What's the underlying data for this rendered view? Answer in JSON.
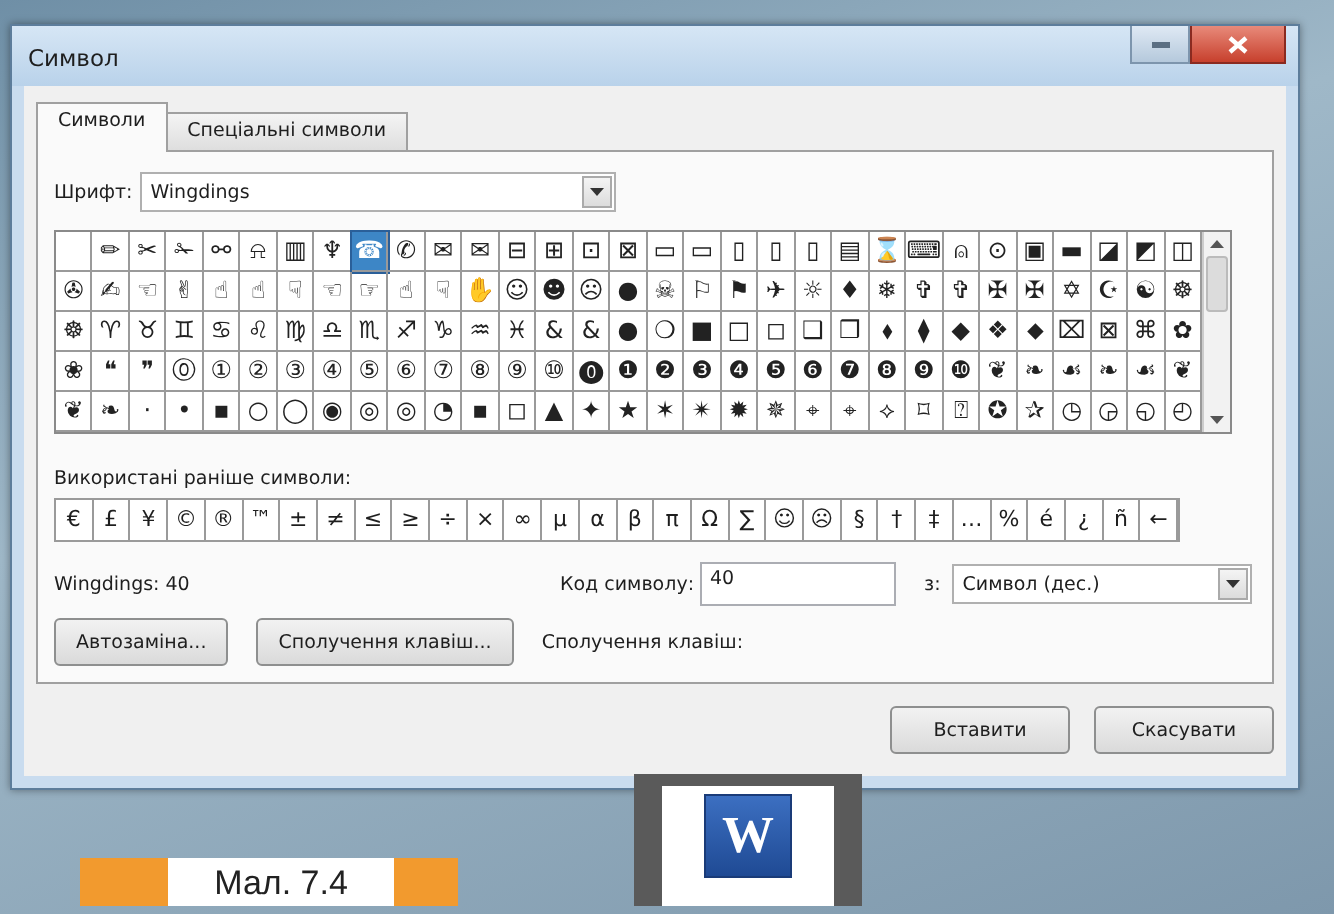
{
  "window": {
    "title": "Символ"
  },
  "tabs": [
    {
      "label": "Символи",
      "selected": true
    },
    {
      "label": "Спеціальні символи",
      "selected": false
    }
  ],
  "font": {
    "label": "Шрифт:",
    "value": "Wingdings"
  },
  "symbol_grid": {
    "rows": [
      {
        "cells": [
          {
            "selected": false
          },
          {
            "ch": "✏",
            "selected": false
          },
          {
            "ch": "✂",
            "selected": false
          },
          {
            "ch": "✁",
            "selected": false
          },
          {
            "ch": "⚯",
            "selected": false
          },
          {
            "ch": "⍾",
            "selected": false
          },
          {
            "ch": "▥",
            "selected": false
          },
          {
            "ch": "♆",
            "selected": false
          },
          {
            "ch": "☎",
            "selected": true
          },
          {
            "ch": "✆",
            "selected": false
          },
          {
            "ch": "✉",
            "selected": false
          },
          {
            "ch": "✉",
            "selected": false
          },
          {
            "ch": "⊟",
            "selected": false
          },
          {
            "ch": "⊞",
            "selected": false
          },
          {
            "ch": "⊡",
            "selected": false
          },
          {
            "ch": "⊠",
            "selected": false
          },
          {
            "ch": "▭",
            "selected": false
          },
          {
            "ch": "▭",
            "selected": false
          },
          {
            "ch": "▯",
            "selected": false
          },
          {
            "ch": "▯",
            "selected": false
          },
          {
            "ch": "▯",
            "selected": false
          },
          {
            "ch": "▤",
            "selected": false
          },
          {
            "ch": "⌛",
            "selected": false
          },
          {
            "ch": "⌨",
            "selected": false
          },
          {
            "ch": "⍝",
            "selected": false
          },
          {
            "ch": "⊙",
            "selected": false
          },
          {
            "ch": "▣",
            "selected": false
          },
          {
            "ch": "▬",
            "selected": false
          },
          {
            "ch": "◪",
            "selected": false
          },
          {
            "ch": "◩",
            "selected": false
          },
          {
            "ch": "◫",
            "selected": false
          }
        ]
      },
      {
        "cells": [
          {
            "ch": "✇",
            "selected": false
          },
          {
            "ch": "✍",
            "selected": false
          },
          {
            "ch": "☜",
            "selected": false
          },
          {
            "ch": "✌",
            "selected": false
          },
          {
            "ch": "☝",
            "selected": false
          },
          {
            "ch": "☝",
            "selected": false
          },
          {
            "ch": "☟",
            "selected": false
          },
          {
            "ch": "☜",
            "selected": false
          },
          {
            "ch": "☞",
            "selected": false
          },
          {
            "ch": "☝",
            "selected": false
          },
          {
            "ch": "☟",
            "selected": false
          },
          {
            "ch": "✋",
            "selected": false
          },
          {
            "ch": "☺",
            "selected": false
          },
          {
            "ch": "☻",
            "selected": false
          },
          {
            "ch": "☹",
            "selected": false
          },
          {
            "ch": "●",
            "selected": false
          },
          {
            "ch": "☠",
            "selected": false
          },
          {
            "ch": "⚐",
            "selected": false
          },
          {
            "ch": "⚑",
            "selected": false
          },
          {
            "ch": "✈",
            "selected": false
          },
          {
            "ch": "☼",
            "selected": false
          },
          {
            "ch": "♦",
            "selected": false
          },
          {
            "ch": "❄",
            "selected": false
          },
          {
            "ch": "✞",
            "selected": false
          },
          {
            "ch": "✞",
            "selected": false
          },
          {
            "ch": "✠",
            "selected": false
          },
          {
            "ch": "✠",
            "selected": false
          },
          {
            "ch": "✡",
            "selected": false
          },
          {
            "ch": "☪",
            "selected": false
          },
          {
            "ch": "☯",
            "selected": false
          },
          {
            "ch": "☸",
            "selected": false
          }
        ]
      },
      {
        "cells": [
          {
            "ch": "☸",
            "selected": false
          },
          {
            "ch": "♈",
            "selected": false
          },
          {
            "ch": "♉",
            "selected": false
          },
          {
            "ch": "♊",
            "selected": false
          },
          {
            "ch": "♋",
            "selected": false
          },
          {
            "ch": "♌",
            "selected": false
          },
          {
            "ch": "♍",
            "selected": false
          },
          {
            "ch": "♎",
            "selected": false
          },
          {
            "ch": "♏",
            "selected": false
          },
          {
            "ch": "♐",
            "selected": false
          },
          {
            "ch": "♑",
            "selected": false
          },
          {
            "ch": "♒",
            "selected": false
          },
          {
            "ch": "♓",
            "selected": false
          },
          {
            "ch": "&",
            "selected": false
          },
          {
            "ch": "&",
            "selected": false
          },
          {
            "ch": "●",
            "selected": false
          },
          {
            "ch": "❍",
            "selected": false
          },
          {
            "ch": "■",
            "selected": false
          },
          {
            "ch": "□",
            "selected": false
          },
          {
            "ch": "◻",
            "selected": false
          },
          {
            "ch": "❑",
            "selected": false
          },
          {
            "ch": "❒",
            "selected": false
          },
          {
            "ch": "⬧",
            "selected": false
          },
          {
            "ch": "⧫",
            "selected": false
          },
          {
            "ch": "◆",
            "selected": false
          },
          {
            "ch": "❖",
            "selected": false
          },
          {
            "ch": "⬥",
            "selected": false
          },
          {
            "ch": "⌧",
            "selected": false
          },
          {
            "ch": "⊠",
            "selected": false
          },
          {
            "ch": "⌘",
            "selected": false
          },
          {
            "ch": "✿",
            "selected": false
          }
        ]
      },
      {
        "cells": [
          {
            "ch": "❀",
            "selected": false
          },
          {
            "ch": "❝",
            "selected": false
          },
          {
            "ch": "❞",
            "selected": false
          },
          {
            "ch": "⓪",
            "selected": false
          },
          {
            "ch": "①",
            "selected": false
          },
          {
            "ch": "②",
            "selected": false
          },
          {
            "ch": "③",
            "selected": false
          },
          {
            "ch": "④",
            "selected": false
          },
          {
            "ch": "⑤",
            "selected": false
          },
          {
            "ch": "⑥",
            "selected": false
          },
          {
            "ch": "⑦",
            "selected": false
          },
          {
            "ch": "⑧",
            "selected": false
          },
          {
            "ch": "⑨",
            "selected": false
          },
          {
            "ch": "⑩",
            "selected": false
          },
          {
            "ch": "⓿",
            "selected": false
          },
          {
            "ch": "❶",
            "selected": false
          },
          {
            "ch": "❷",
            "selected": false
          },
          {
            "ch": "❸",
            "selected": false
          },
          {
            "ch": "❹",
            "selected": false
          },
          {
            "ch": "❺",
            "selected": false
          },
          {
            "ch": "❻",
            "selected": false
          },
          {
            "ch": "❼",
            "selected": false
          },
          {
            "ch": "❽",
            "selected": false
          },
          {
            "ch": "❾",
            "selected": false
          },
          {
            "ch": "❿",
            "selected": false
          },
          {
            "ch": "❦",
            "selected": false
          },
          {
            "ch": "❧",
            "selected": false
          },
          {
            "ch": "☙",
            "selected": false
          },
          {
            "ch": "❧",
            "selected": false
          },
          {
            "ch": "☙",
            "selected": false
          },
          {
            "ch": "❦",
            "selected": false
          }
        ]
      },
      {
        "cells": [
          {
            "ch": "❦",
            "selected": false
          },
          {
            "ch": "❧",
            "selected": false
          },
          {
            "ch": "·",
            "selected": false
          },
          {
            "ch": "•",
            "selected": false
          },
          {
            "ch": "▪",
            "selected": false
          },
          {
            "ch": "○",
            "selected": false
          },
          {
            "ch": "◯",
            "selected": false
          },
          {
            "ch": "◉",
            "selected": false
          },
          {
            "ch": "◎",
            "selected": false
          },
          {
            "ch": "◎",
            "selected": false
          },
          {
            "ch": "◔",
            "selected": false
          },
          {
            "ch": "▪",
            "selected": false
          },
          {
            "ch": "◻",
            "selected": false
          },
          {
            "ch": "▲",
            "selected": false
          },
          {
            "ch": "✦",
            "selected": false
          },
          {
            "ch": "★",
            "selected": false
          },
          {
            "ch": "✶",
            "selected": false
          },
          {
            "ch": "✴",
            "selected": false
          },
          {
            "ch": "✹",
            "selected": false
          },
          {
            "ch": "✵",
            "selected": false
          },
          {
            "ch": "⌖",
            "selected": false
          },
          {
            "ch": "⌖",
            "selected": false
          },
          {
            "ch": "⟡",
            "selected": false
          },
          {
            "ch": "⌑",
            "selected": false
          },
          {
            "ch": "⍰",
            "selected": false
          },
          {
            "ch": "✪",
            "selected": false
          },
          {
            "ch": "✰",
            "selected": false
          },
          {
            "ch": "◷",
            "selected": false
          },
          {
            "ch": "◶",
            "selected": false
          },
          {
            "ch": "◵",
            "selected": false
          },
          {
            "ch": "◴",
            "selected": false
          }
        ]
      }
    ]
  },
  "recent": {
    "label": "Використані раніше символи:",
    "symbols": [
      "€",
      "£",
      "¥",
      "©",
      "®",
      "™",
      "±",
      "≠",
      "≤",
      "≥",
      "÷",
      "×",
      "∞",
      "µ",
      "α",
      "β",
      "π",
      "Ω",
      "∑",
      "☺",
      "☹",
      "§",
      "†",
      "‡",
      "…",
      "%",
      "é",
      "¿",
      "ñ",
      "←"
    ]
  },
  "char_name": "Wingdings: 40",
  "code": {
    "label": "Код символу:",
    "value": "40"
  },
  "from": {
    "label": "з:",
    "value": "Символ (дес.)"
  },
  "tool_buttons": [
    {
      "label": "Автозаміна..."
    },
    {
      "label": "Сполучення клавіш..."
    }
  ],
  "shortcut_label": "Сполучення клавіш:",
  "actions": [
    {
      "label": "Вставити"
    },
    {
      "label": "Скасувати"
    }
  ],
  "caption": "Мал. 7.4",
  "app_logo": {
    "letter": "W"
  }
}
